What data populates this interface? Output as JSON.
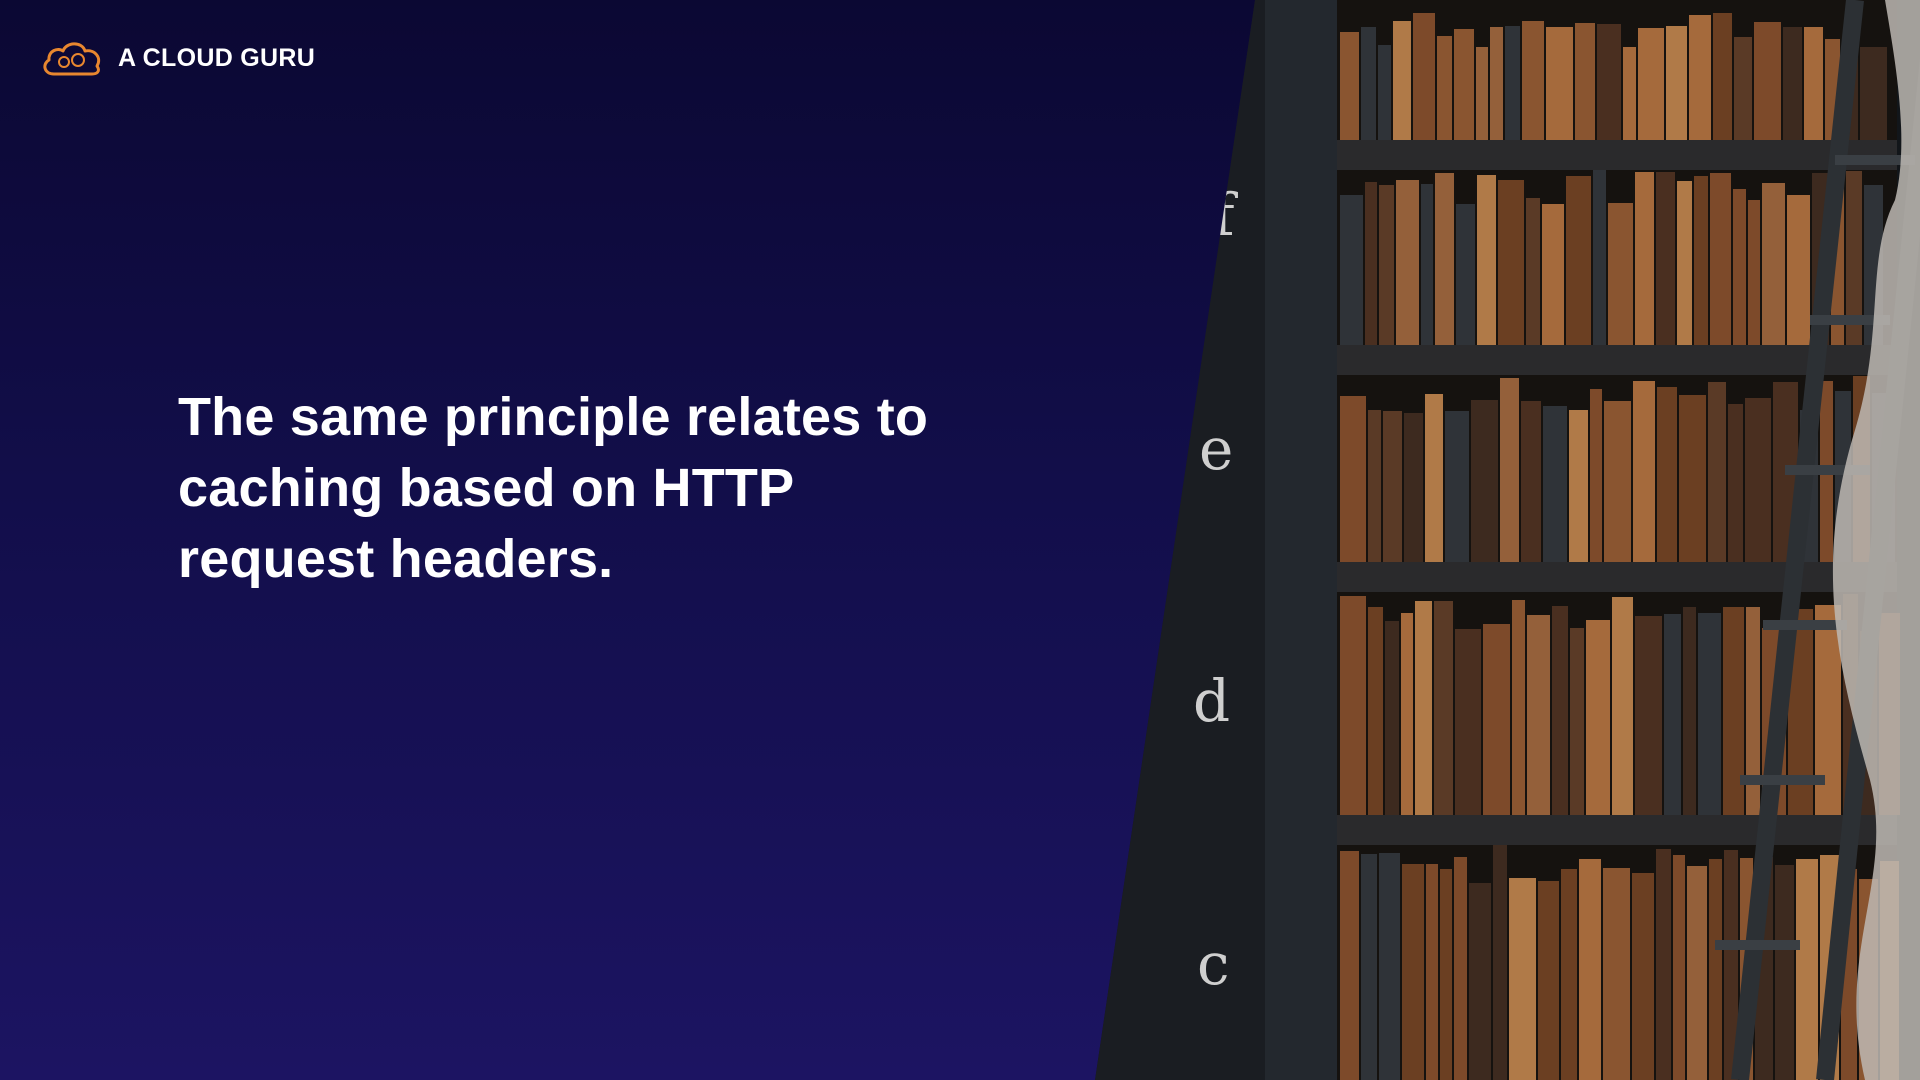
{
  "brand": {
    "name": "A CLOUD GURU",
    "logo_icon": "cloud-logo-icon",
    "accent_color": "#e8872f"
  },
  "slide": {
    "headline_lines": [
      "The same principle relates to",
      "caching based on HTTP",
      "request headers."
    ],
    "background_color": "#120e4a",
    "text_color": "#ffffff"
  },
  "photo": {
    "subject": "library bookshelf with ladder",
    "spine_letters": [
      "f",
      "e",
      "d",
      "c"
    ]
  }
}
